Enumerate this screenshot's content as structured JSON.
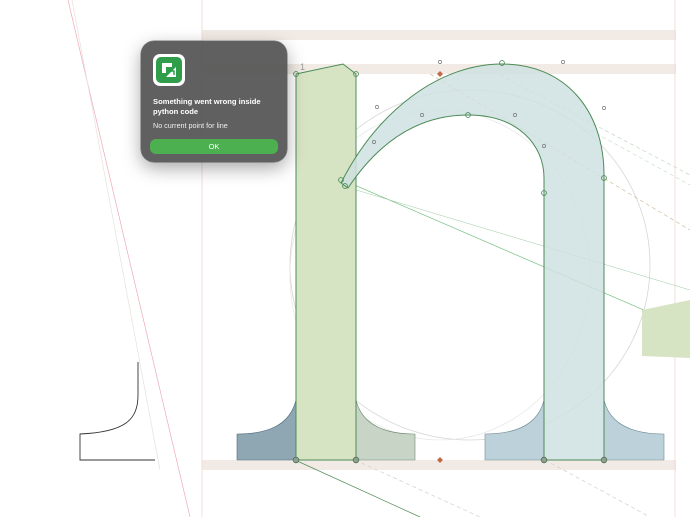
{
  "editor": {
    "guide_number": "1",
    "colors": {
      "metric_band": "#f2ebe5",
      "stem_fill": "#d7e4c4",
      "arch_fill": "#cfe0e0",
      "outline": "#4c8b58",
      "serif_dark": "#8ea7b2",
      "serif_light": "#bdd1da",
      "guide_pink": "#f1a9b4",
      "guide_green": "#76bf82",
      "guide_gray": "#c9c9c9"
    }
  },
  "alert": {
    "app_icon": "app-icon-green-arrow",
    "title": "Something went wrong inside python code",
    "message": "No current point for line",
    "ok_label": "OK",
    "button_color": "#4caf50"
  }
}
